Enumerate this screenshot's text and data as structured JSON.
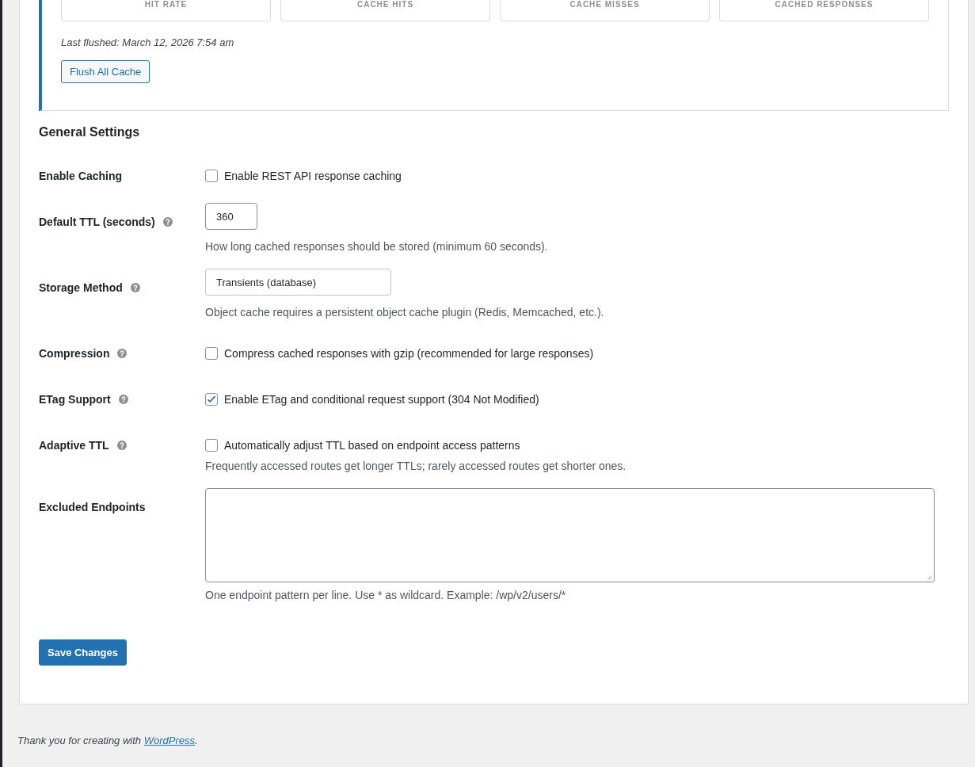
{
  "stats": [
    {
      "label": "HIT RATE"
    },
    {
      "label": "CACHE HITS"
    },
    {
      "label": "CACHE MISSES"
    },
    {
      "label": "CACHED RESPONSES"
    }
  ],
  "last_flushed": "Last flushed: March 12, 2026 7:54 am",
  "flush_button": "Flush All Cache",
  "section_title": "General Settings",
  "settings": [
    {
      "kind": "checkbox",
      "label": "Enable Caching",
      "help_icon": false,
      "text": "Enable REST API response caching",
      "checked": false
    },
    {
      "kind": "number",
      "label": "Default TTL (seconds)",
      "help_icon": true,
      "value": "360",
      "description": "How long cached responses should be stored (minimum 60 seconds)."
    },
    {
      "kind": "select",
      "label": "Storage Method",
      "help_icon": true,
      "value": "Transients (database)",
      "description": "Object cache requires a persistent object cache plugin (Redis, Memcached, etc.)."
    },
    {
      "kind": "checkbox",
      "label": "Compression",
      "help_icon": true,
      "text": "Compress cached responses with gzip (recommended for large responses)",
      "checked": false
    },
    {
      "kind": "checkbox",
      "label": "ETag Support",
      "help_icon": true,
      "text": "Enable ETag and conditional request support (304 Not Modified)",
      "checked": true
    },
    {
      "kind": "checkbox",
      "label": "Adaptive TTL",
      "help_icon": true,
      "text": "Automatically adjust TTL based on endpoint access patterns",
      "checked": false,
      "description": "Frequently accessed routes get longer TTLs; rarely accessed routes get shorter ones."
    },
    {
      "kind": "textarea",
      "label": "Excluded Endpoints",
      "help_icon": false,
      "description": "One endpoint pattern per line. Use * as wildcard. Example: /wp/v2/users/*"
    }
  ],
  "save_button": "Save Changes",
  "footer": {
    "text": "Thank you for creating with ",
    "link": "WordPress",
    "after": "."
  }
}
